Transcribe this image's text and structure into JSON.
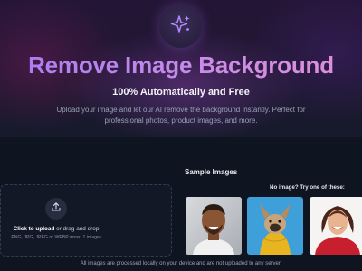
{
  "header": {
    "logo_icon": "sparkles-icon",
    "title": "Remove Image Background",
    "subtitle": "100% Automatically and Free",
    "description": "Upload your image and let our AI remove the background instantly. Perfect for professional photos, product images, and more."
  },
  "upload": {
    "icon": "upload-icon",
    "click_label": "Click to upload",
    "drag_label": " or drag and drop",
    "formats": "PNG, JPG, JPEG or WEBP (max. 1 image)"
  },
  "samples": {
    "heading": "Sample Images",
    "prompt": "No image? Try one of these:",
    "items": [
      {
        "name": "man-portrait"
      },
      {
        "name": "dog-with-sweater"
      },
      {
        "name": "woman-portrait"
      }
    ]
  },
  "footer": {
    "privacy_note": "All images are processed locally on your device and are not uploaded to any server."
  },
  "colors": {
    "accent_start": "#a67cf2",
    "accent_end": "#e08fd6",
    "background": "#0f1421"
  }
}
